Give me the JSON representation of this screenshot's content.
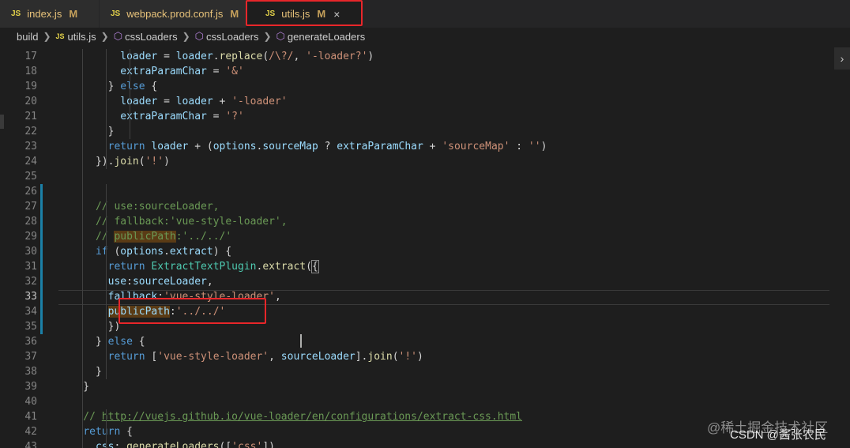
{
  "tabs": [
    {
      "label": "index.js",
      "badge": "M"
    },
    {
      "label": "webpack.prod.conf.js",
      "badge": "M"
    },
    {
      "label": "utils.js",
      "badge": "M",
      "close": "×"
    }
  ],
  "js_icon": "JS",
  "breadcrumb": [
    "build",
    "utils.js",
    "cssLoaders",
    "cssLoaders",
    "generateLoaders"
  ],
  "line_numbers": [
    "17",
    "18",
    "19",
    "20",
    "21",
    "22",
    "23",
    "24",
    "25",
    "26",
    "27",
    "28",
    "29",
    "30",
    "31",
    "32",
    "33",
    "34",
    "35",
    "36",
    "37",
    "38",
    "39",
    "40",
    "41",
    "42",
    "43"
  ],
  "code_lines": [
    "          loader = loader.replace(/\\?/, '-loader?')",
    "          extraParamChar = '&'",
    "        } else {",
    "          loader = loader + '-loader'",
    "          extraParamChar = '?'",
    "        }",
    "        return loader + (options.sourceMap ? extraParamChar + 'sourceMap' : '')",
    "      }).join('!')",
    "",
    "",
    "      // use:sourceLoader,",
    "      // fallback:'vue-style-loader',",
    "      // publicPath:'../../'",
    "      if (options.extract) {",
    "        return ExtractTextPlugin.extract({",
    "        use:sourceLoader,",
    "        fallback:'vue-style-loader',",
    "        publicPath:'../../'",
    "        })",
    "      } else {",
    "        return ['vue-style-loader', sourceLoader].join('!')",
    "      }",
    "    }",
    "",
    "    // http://vuejs.github.io/vue-loader/en/configurations/extract-css.html",
    "    return {",
    "      css: generateLoaders(['css'])"
  ],
  "watermarks": [
    "@稀土掘金技术社区",
    "CSDN @酱张农民"
  ],
  "scroll_icon": "›",
  "colors": {
    "highlight": "#e8262a",
    "keyword": "#569cd6",
    "comment": "#6a9955",
    "string": "#ce9178"
  }
}
